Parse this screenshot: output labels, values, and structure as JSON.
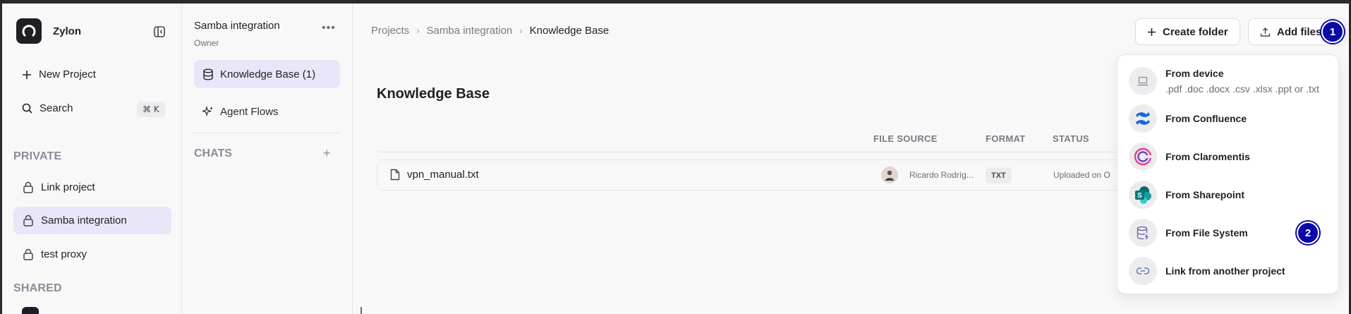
{
  "app": {
    "name": "Zylon"
  },
  "sidebar": {
    "new_project": "New Project",
    "search": "Search",
    "search_shortcut": "⌘ K",
    "private_label": "PRIVATE",
    "projects": [
      {
        "label": "Link project",
        "active": false
      },
      {
        "label": "Samba integration",
        "active": true
      },
      {
        "label": "test proxy",
        "active": false
      }
    ],
    "shared_label": "SHARED"
  },
  "project_panel": {
    "title": "Samba integration",
    "role": "Owner",
    "nav": [
      {
        "label": "Knowledge Base (1)",
        "active": true
      },
      {
        "label": "Agent Flows",
        "active": false
      }
    ],
    "chats_label": "CHATS"
  },
  "breadcrumb": [
    "Projects",
    "Samba integration",
    "Knowledge Base"
  ],
  "toolbar": {
    "create_folder": "Create folder",
    "add_files": "Add files"
  },
  "annotations": [
    "1",
    "2"
  ],
  "main": {
    "title": "Knowledge Base",
    "columns": [
      "FILE SOURCE",
      "FORMAT",
      "STATUS"
    ],
    "rows": [
      {
        "name": "vpn_manual.txt",
        "owner": "Ricardo Rodríg...",
        "format": "TXT",
        "status": "Uploaded on O"
      }
    ]
  },
  "add_files_menu": {
    "items": [
      {
        "label": "From device",
        "sub": ".pdf .doc .docx .csv .xlsx .ppt or .txt",
        "icon": "laptop-icon"
      },
      {
        "label": "From Confluence",
        "icon": "confluence-icon"
      },
      {
        "label": "From Claromentis",
        "icon": "claromentis-icon"
      },
      {
        "label": "From Sharepoint",
        "icon": "sharepoint-icon"
      },
      {
        "label": "From File System",
        "icon": "database-icon"
      },
      {
        "label": "Link from another project",
        "icon": "link-icon"
      }
    ]
  },
  "colors": {
    "accent": "#eae6f9",
    "badge": "#0a0aa8",
    "confluence": "#1868db",
    "sharepoint": "#036c70"
  }
}
